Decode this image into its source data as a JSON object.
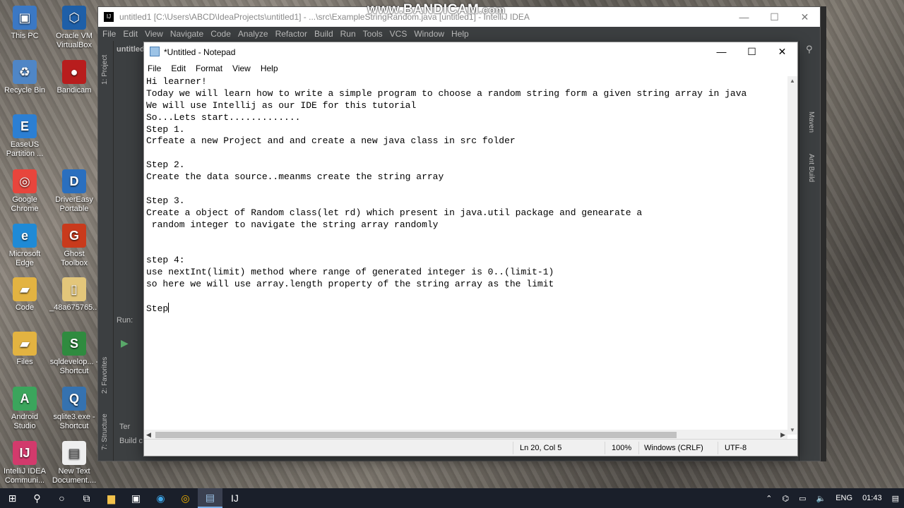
{
  "watermark": {
    "main": "www.BANDICAM",
    "suffix": ".com"
  },
  "desktop_icons": [
    {
      "label": "This PC",
      "icon": "computer-icon"
    },
    {
      "label": "Oracle VM VirtualBox",
      "icon": "virtualbox-icon"
    },
    {
      "label": "Recycle Bin",
      "icon": "recycle-bin-icon"
    },
    {
      "label": "Bandicam",
      "icon": "bandicam-icon"
    },
    {
      "label": "EaseUS Partition ...",
      "icon": "easeus-icon"
    },
    {
      "label": "Google Chrome",
      "icon": "chrome-icon"
    },
    {
      "label": "DriverEasy Portable",
      "icon": "drivereasy-icon"
    },
    {
      "label": "Microsoft Edge",
      "icon": "edge-icon"
    },
    {
      "label": "Ghost Toolbox",
      "icon": "ghost-toolbox-icon"
    },
    {
      "label": "Code",
      "icon": "folder-icon"
    },
    {
      "label": "_48a675765...",
      "icon": "file-icon"
    },
    {
      "label": "Files",
      "icon": "folder-icon"
    },
    {
      "label": "sqldevelop... - Shortcut",
      "icon": "sqldeveloper-icon"
    },
    {
      "label": "Android Studio",
      "icon": "android-studio-icon"
    },
    {
      "label": "sqlite3.exe - Shortcut",
      "icon": "sqlite-icon"
    },
    {
      "label": "IntelliJ IDEA Communi...",
      "icon": "intellij-icon"
    },
    {
      "label": "New Text Document....",
      "icon": "text-document-icon"
    }
  ],
  "intellij": {
    "title": "untitled1 [C:\\Users\\ABCD\\IdeaProjects\\untitled1] - ...\\src\\ExampleStringRandom.java [untitled1] - IntelliJ IDEA",
    "menu": [
      "File",
      "Edit",
      "View",
      "Navigate",
      "Code",
      "Analyze",
      "Refactor",
      "Build",
      "Run",
      "Tools",
      "VCS",
      "Window",
      "Help"
    ],
    "project_label": "untitled",
    "side_tabs": [
      "1: Project",
      "2: Favorites",
      "7: Structure"
    ],
    "right_tabs": [
      "Maven",
      "Ant Build"
    ],
    "run_label": "Run:",
    "terminal_label": "Ter",
    "build_label": "Build c"
  },
  "notepad": {
    "title": "*Untitled - Notepad",
    "menu": [
      "File",
      "Edit",
      "Format",
      "View",
      "Help"
    ],
    "lines": [
      "Hi learner!",
      "Today we will learn how to write a simple program to choose a random string form a given string array in java",
      "We will use Intellij as our IDE for this tutorial",
      "So...Lets start.............",
      "Step 1.",
      "Crfeate a new Project and and create a new java class in src folder",
      "",
      "Step 2.",
      "Create the data source..meanms create the string array",
      "",
      "Step 3.",
      "Create a object of Random class(let rd) which present in java.util package and genearate a",
      " random integer to navigate the string array randomly",
      "",
      "",
      "step 4:",
      "use nextInt(limit) method where range of generated integer is 0..(limit-1)",
      "so here we will use array.length property of the string array as the limit",
      "",
      "Step"
    ],
    "status": {
      "position": "Ln 20, Col 5",
      "zoom": "100%",
      "line_ending": "Windows (CRLF)",
      "encoding": "UTF-8"
    }
  },
  "taskbar": {
    "language": "ENG",
    "time": "01:43"
  }
}
